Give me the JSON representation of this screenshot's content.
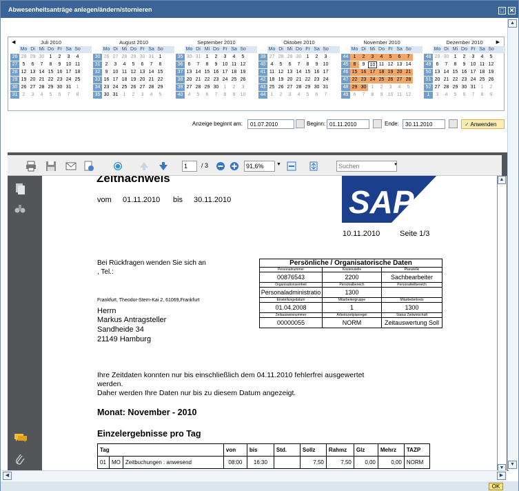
{
  "window": {
    "title": "Abwesenheitsanträge anlegen/ändern/stornieren",
    "btn_restore": "□",
    "btn_close": "✕"
  },
  "calendar": {
    "nav_prev": "◀",
    "nav_next": "▶",
    "dow": [
      "Mo",
      "Di",
      "Mi",
      "Do",
      "Fr",
      "Sa",
      "So"
    ],
    "months": [
      {
        "name": "Juli 2010",
        "weeks": [
          [
            "26",
            "28",
            "29",
            "30",
            "1",
            "2",
            "3",
            "4"
          ],
          [
            "27",
            "5",
            "6",
            "7",
            "8",
            "9",
            "10",
            "11"
          ],
          [
            "28",
            "12",
            "13",
            "14",
            "15",
            "16",
            "17",
            "18"
          ],
          [
            "29",
            "19",
            "20",
            "21",
            "22",
            "23",
            "24",
            "25"
          ],
          [
            "30",
            "26",
            "27",
            "28",
            "29",
            "30",
            "31",
            "1"
          ],
          [
            "31",
            "2",
            "3",
            "4",
            "5",
            "6",
            "7",
            "8"
          ]
        ]
      },
      {
        "name": "August 2010",
        "weeks": [
          [
            "30",
            "26",
            "27",
            "28",
            "29",
            "30",
            "31",
            "1"
          ],
          [
            "31",
            "2",
            "3",
            "4",
            "5",
            "6",
            "7",
            "8"
          ],
          [
            "32",
            "9",
            "10",
            "11",
            "12",
            "13",
            "14",
            "15"
          ],
          [
            "33",
            "16",
            "17",
            "18",
            "19",
            "20",
            "21",
            "22"
          ],
          [
            "34",
            "23",
            "24",
            "25",
            "26",
            "27",
            "28",
            "29"
          ],
          [
            "35",
            "30",
            "31",
            "1",
            "2",
            "3",
            "4",
            "5"
          ]
        ]
      },
      {
        "name": "September 2010",
        "weeks": [
          [
            "35",
            "30",
            "31",
            "1",
            "2",
            "3",
            "4",
            "5"
          ],
          [
            "36",
            "6",
            "7",
            "8",
            "9",
            "10",
            "11",
            "12"
          ],
          [
            "37",
            "13",
            "14",
            "15",
            "16",
            "17",
            "18",
            "19"
          ],
          [
            "38",
            "20",
            "21",
            "22",
            "23",
            "24",
            "25",
            "26"
          ],
          [
            "39",
            "27",
            "28",
            "29",
            "30",
            "1",
            "2",
            "3"
          ],
          [
            "40",
            "4",
            "5",
            "6",
            "7",
            "8",
            "9",
            "10"
          ]
        ]
      },
      {
        "name": "Oktober 2010",
        "weeks": [
          [
            "39",
            "27",
            "28",
            "29",
            "30",
            "1",
            "2",
            "3"
          ],
          [
            "40",
            "4",
            "5",
            "6",
            "7",
            "8",
            "9",
            "10"
          ],
          [
            "41",
            "11",
            "12",
            "13",
            "14",
            "15",
            "16",
            "17"
          ],
          [
            "42",
            "18",
            "19",
            "20",
            "21",
            "22",
            "23",
            "24"
          ],
          [
            "43",
            "25",
            "26",
            "27",
            "28",
            "29",
            "30",
            "31"
          ],
          [
            "44",
            "1",
            "2",
            "3",
            "4",
            "5",
            "6",
            "7"
          ]
        ]
      },
      {
        "name": "November 2010",
        "weeks": [
          [
            "44",
            "1",
            "2",
            "3",
            "4",
            "5",
            "6",
            "7"
          ],
          [
            "45",
            "8",
            "9",
            "10",
            "11",
            "12",
            "13",
            "14"
          ],
          [
            "46",
            "15",
            "16",
            "17",
            "18",
            "19",
            "20",
            "21"
          ],
          [
            "47",
            "22",
            "23",
            "24",
            "25",
            "26",
            "27",
            "28"
          ],
          [
            "48",
            "29",
            "30",
            "1",
            "2",
            "3",
            "4",
            "5"
          ],
          [
            "49",
            "6",
            "7",
            "8",
            "9",
            "10",
            "11",
            "12"
          ]
        ]
      },
      {
        "name": "Dezember 2010",
        "weeks": [
          [
            "48",
            "29",
            "30",
            "1",
            "2",
            "3",
            "4",
            "5"
          ],
          [
            "49",
            "6",
            "7",
            "8",
            "9",
            "10",
            "11",
            "12"
          ],
          [
            "50",
            "13",
            "14",
            "15",
            "16",
            "17",
            "18",
            "19"
          ],
          [
            "51",
            "20",
            "21",
            "22",
            "23",
            "24",
            "25",
            "26"
          ],
          [
            "52",
            "27",
            "28",
            "29",
            "30",
            "31",
            "1",
            "2"
          ],
          [
            "1",
            "3",
            "4",
            "5",
            "6",
            "7",
            "8",
            "9"
          ]
        ]
      }
    ],
    "selection_color": "#f2a76a",
    "week_color": "#6e9ed0"
  },
  "range": {
    "anzeige_label": "Anzeige beginnt am:",
    "anzeige_value": "01.07.2010",
    "beginn_label": "Beginn:",
    "beginn_value": "01.11.2010",
    "ende_label": "Ende:",
    "ende_value": "30.11.2010",
    "apply_label": "Anwenden"
  },
  "pdf_toolbar": {
    "page_value": "1",
    "page_total": "/ 3",
    "zoom_value": "91,6%",
    "search_placeholder": "Suchen"
  },
  "document": {
    "title": "Zeitnachweis",
    "vom_label": "vom",
    "vom_value": "01.11.2010",
    "bis_label": "bis",
    "bis_value": "30.11.2010",
    "logo_text": "SAP",
    "print_date": "10.11.2010",
    "seite": "Seite 1/3",
    "rueckfragen": "Bei Rückfragen wenden Sie sich an",
    "tel": ", Tel.:",
    "sender": "Frankfurt, Theodor-Stern-Kai 2, 61069,Frankfurt",
    "addr": [
      "Herrn",
      "Markus Antragsteller",
      "Sandheide 34",
      "21149 Hamburg"
    ],
    "pers_title": "Persönliche / Organisatorische Daten",
    "pers_rows": [
      {
        "labels": [
          "Personalnummer",
          "Kostenstelle",
          "Planstelle"
        ],
        "values": [
          "00876543",
          "2200",
          "Sachbearbeiter"
        ]
      },
      {
        "labels": [
          "Organisationseinheit",
          "Personalbereich",
          "Personalteilbereich"
        ],
        "values": [
          "Personaladministratio",
          "1300",
          ""
        ]
      },
      {
        "labels": [
          "Einstellungsdatum",
          "Mitarbeitergruppe",
          "Mitarbeiterkreis"
        ],
        "values": [
          "01.04.2008",
          "1",
          "1300"
        ]
      },
      {
        "labels": [
          "Zeitausweisnummer",
          "Arbeitszeitplanregel",
          "Status Zeitwirtschaft"
        ],
        "values": [
          "00000055",
          "NORM",
          "Zeitauswertung Soll"
        ]
      }
    ],
    "info1": "Ihre Zeitdaten konnten nur bis einschließlich dem    04.11.2010 fehlerfrei ausgewertet",
    "info2": "werden.",
    "info3": "Daher werden Ihre Daten nur bis zu diesem Datum angezeigt.",
    "monat": "Monat: November - 2010",
    "einzel": "Einzelergebnisse pro Tag",
    "res_headers": [
      "Tag",
      "",
      "",
      "von",
      "bis",
      "Std.",
      "Sollz",
      "Rahmz",
      "Glz",
      "Mehrz",
      "TAZP"
    ],
    "res_row": [
      "01",
      "MO",
      "Zeitbuchungen : anwesend",
      "08:00",
      "16:30",
      "",
      "7,50",
      "7,50",
      "0,00",
      "0,00",
      "NORM"
    ]
  },
  "status": {
    "ok_label": "OK"
  }
}
